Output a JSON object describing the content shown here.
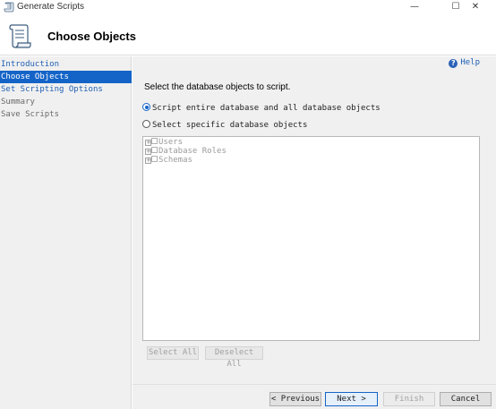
{
  "window": {
    "title": "Generate Scripts",
    "controls": {
      "minimize": "—",
      "maximize": "☐",
      "close": "✕"
    }
  },
  "header": {
    "title": "Choose Objects",
    "icon": "scroll-icon"
  },
  "sidebar": {
    "items": [
      {
        "label": "Introduction",
        "state": "link"
      },
      {
        "label": "Choose Objects",
        "state": "active"
      },
      {
        "label": "Set Scripting Options",
        "state": "link"
      },
      {
        "label": "Summary",
        "state": "disabled"
      },
      {
        "label": "Save Scripts",
        "state": "disabled"
      }
    ]
  },
  "main": {
    "help_label": "Help",
    "instruction": "Select the database objects to script.",
    "options": [
      {
        "label": "Script entire database and all database objects",
        "checked": true
      },
      {
        "label": "Select specific database objects",
        "checked": false
      }
    ],
    "tree": [
      {
        "label": "Users"
      },
      {
        "label": "Database Roles"
      },
      {
        "label": "Schemas"
      }
    ],
    "select_all_label": "Select All",
    "deselect_all_label": "Deselect All"
  },
  "footer": {
    "previous_label": "< Previous",
    "next_label": "Next >",
    "finish_label": "Finish",
    "cancel_label": "Cancel"
  },
  "colors": {
    "accent": "#1464c8",
    "link": "#1e5fb4",
    "panel": "#f0f0f0"
  }
}
